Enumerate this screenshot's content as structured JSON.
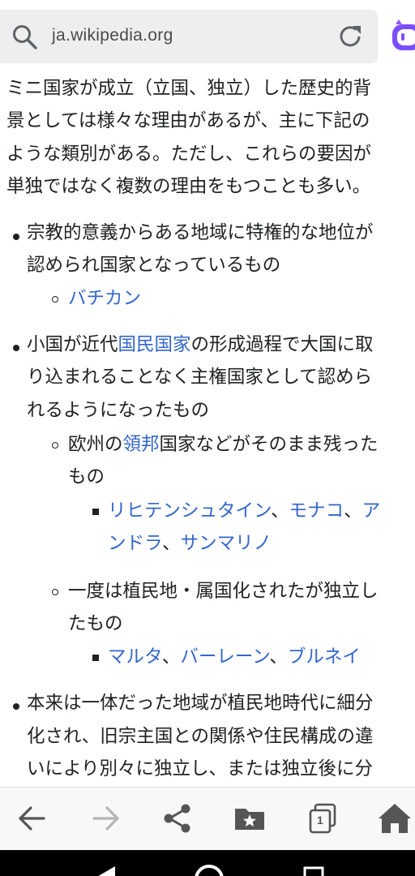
{
  "browser": {
    "url": "ja.wikipedia.org",
    "icons": [
      "search-icon",
      "reload-icon",
      "copilot-icon"
    ]
  },
  "article": {
    "intro": [
      "ミニ国家が成立（立国、独立）した歴史的背",
      "景としては様々な理由があるが、主に下記の",
      "ような類別がある。ただし、これらの要因が",
      "単独ではなく複数の理由をもつことも多い。"
    ],
    "item1": {
      "lines": [
        "宗教的意義からある地域に特権的な地位が",
        "認められ国家となっているもの"
      ],
      "sub_link": "バチカン"
    },
    "item2": {
      "line1_a": "小国が近代",
      "line1_link": "国民国家",
      "line1_b": "の形成過程で大国に取",
      "line2": "り込まれることなく主権国家として認めら",
      "line3": "れるようになったもの",
      "sub1": {
        "a": "欧州の",
        "link": "領邦",
        "b": "国家などがそのまま残った",
        "line2": "もの",
        "links": [
          "リヒテンシュタイン",
          "モナコ",
          "アンドラ",
          "サンマリノ"
        ],
        "link3_part1": "ア",
        "link3_part2": "ンドラ",
        "sep": "、"
      },
      "sub2": {
        "line1": "一度は植民地・属国化されたが独立し",
        "line2": "たもの",
        "links": [
          "マルタ",
          "バーレーン",
          "ブルネイ"
        ]
      }
    },
    "item3": {
      "lines": [
        "本来は一体だった地域が植民地時代に細分",
        "化され、旧宗主国との関係や住民構成の違",
        "いにより別々に独立し、または独立後に分"
      ]
    },
    "link_color": "#3366cc"
  },
  "navbar": {
    "buttons": [
      "back-icon",
      "forward-icon",
      "share-icon",
      "bookmarks-icon",
      "tabs-icon",
      "home-icon"
    ],
    "tab_count": "1"
  }
}
